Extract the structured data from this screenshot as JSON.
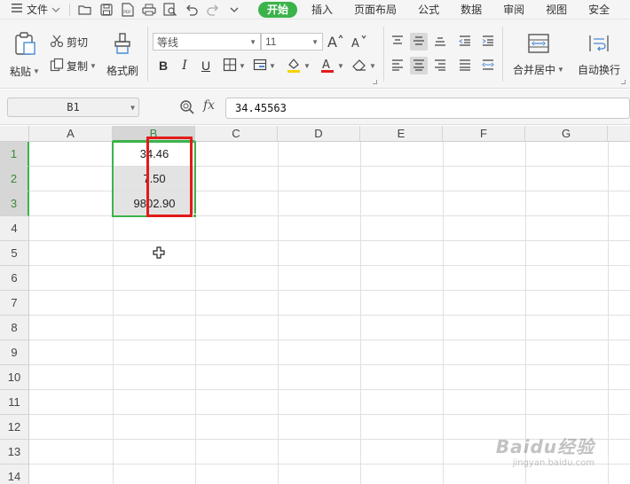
{
  "menubar": {
    "file_label": "文件",
    "tabs": [
      {
        "label": "开始",
        "active": true
      },
      {
        "label": "插入",
        "active": false
      },
      {
        "label": "页面布局",
        "active": false
      },
      {
        "label": "公式",
        "active": false
      },
      {
        "label": "数据",
        "active": false
      },
      {
        "label": "审阅",
        "active": false
      },
      {
        "label": "视图",
        "active": false
      },
      {
        "label": "安全",
        "active": false
      }
    ],
    "quick_access_icons": [
      "open-folder-icon",
      "save-icon",
      "pdf-export-icon",
      "print-icon",
      "print-preview-icon",
      "undo-icon",
      "redo-icon",
      "customize-icon"
    ]
  },
  "ribbon": {
    "paste_label": "粘贴",
    "cut_label": "剪切",
    "copy_label": "复制",
    "format_painter_label": "格式刷",
    "font_name": "等线",
    "font_size": "11",
    "merge_center_label": "合并居中",
    "wrap_text_label": "自动换行",
    "accent_color": "#3cb34a",
    "font_color_bar": "#e21b1b",
    "fill_color_bar": "#f5d400"
  },
  "formula_bar": {
    "name_box": "B1",
    "fx_label": "fx",
    "value": "34.45563"
  },
  "sheet": {
    "columns": [
      "A",
      "B",
      "C",
      "D",
      "E",
      "F",
      "G"
    ],
    "selected_column": "B",
    "rows": [
      "1",
      "2",
      "3",
      "4",
      "5",
      "6",
      "7",
      "8",
      "9",
      "10",
      "11",
      "12",
      "13",
      "14"
    ],
    "selected_rows": [
      "1",
      "2",
      "3"
    ],
    "cells": {
      "B1": "34.46",
      "B2": "7.50",
      "B3": "9802.90"
    },
    "active_cell": "B1",
    "selection": "B1:B3"
  },
  "watermark": {
    "main": "Baidu经验",
    "sub": "jingyan.baidu.com"
  }
}
